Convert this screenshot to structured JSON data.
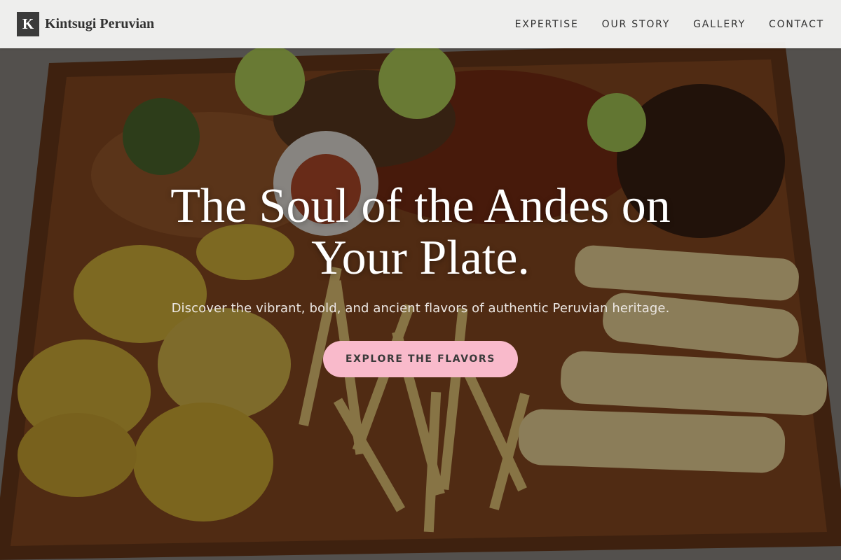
{
  "header": {
    "logo_letter": "K",
    "brand_name": "Kintsugi Peruvian",
    "nav": [
      {
        "label": "EXPERTISE"
      },
      {
        "label": "OUR STORY"
      },
      {
        "label": "GALLERY"
      },
      {
        "label": "CONTACT"
      }
    ]
  },
  "hero": {
    "title": "The Soul of the Andes on Your Plate.",
    "subtitle": "Discover the vibrant, bold, and ancient flavors of authentic Peruvian heritage.",
    "cta_label": "EXPLORE THE FLAVORS",
    "background_image": "food-platter-image"
  },
  "colors": {
    "header_bg": "#f5f5f4",
    "logo_bg": "#3b3b3b",
    "cta_bg": "#f9bacb",
    "text_dark": "#333333",
    "hero_text": "#ffffff"
  }
}
